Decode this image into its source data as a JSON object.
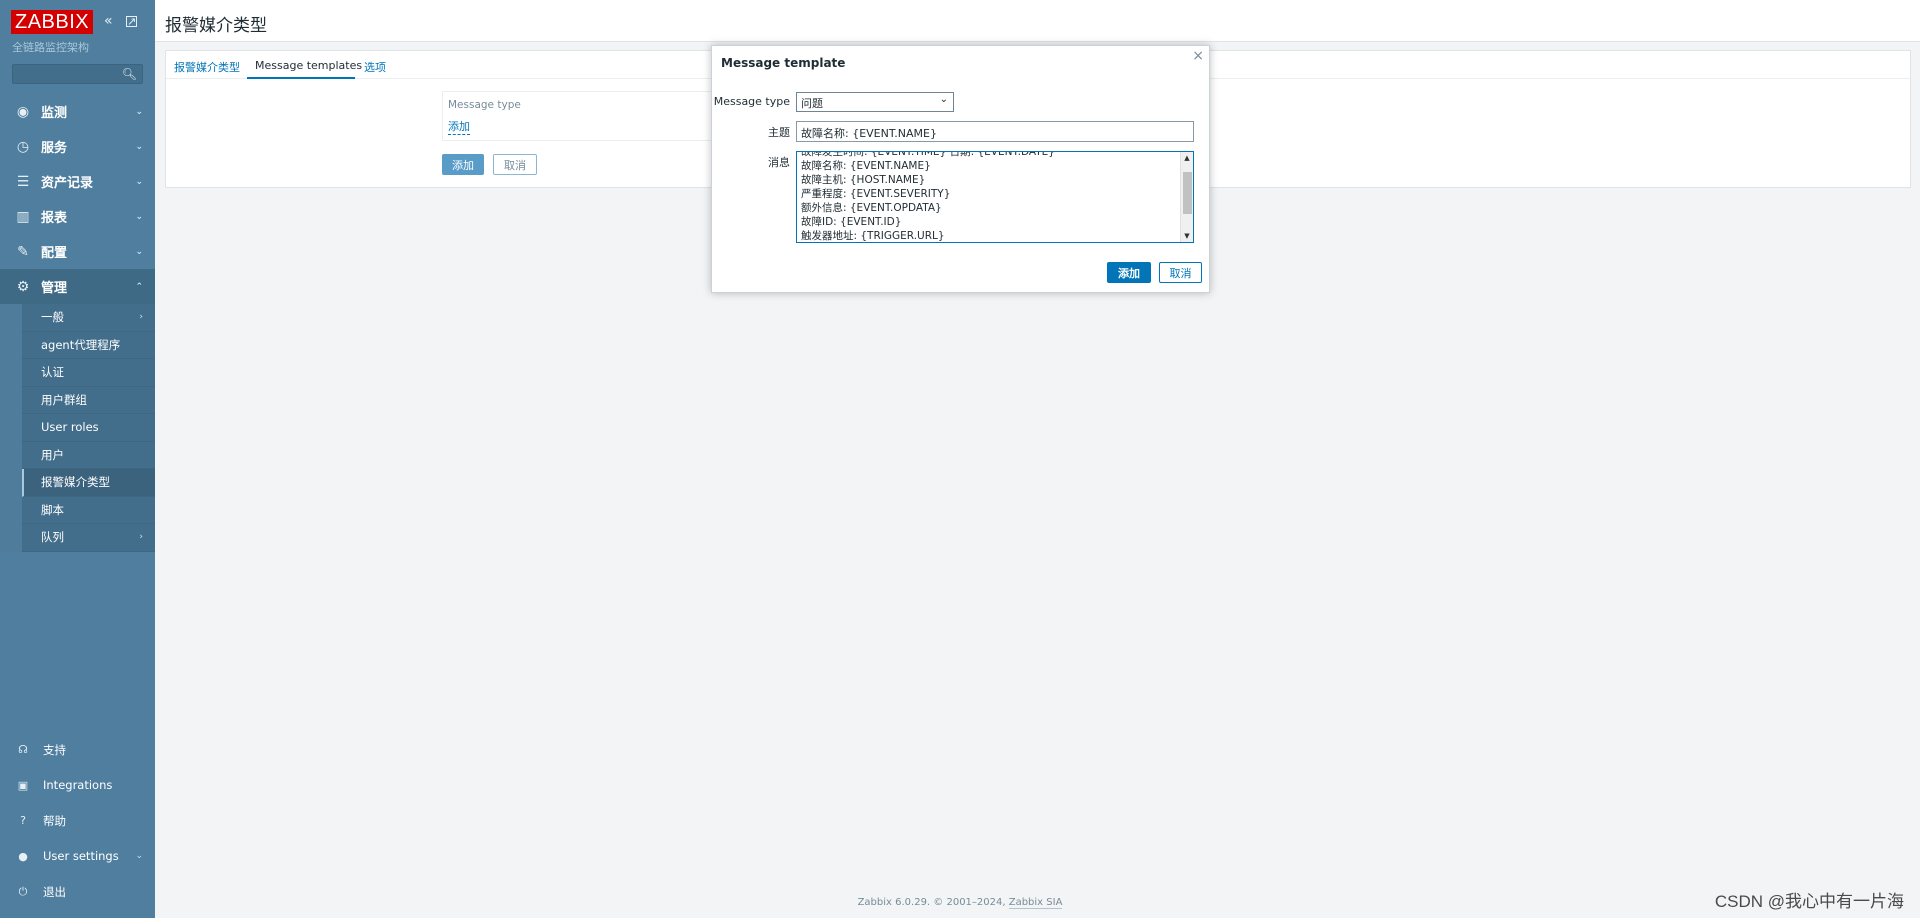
{
  "sidebar": {
    "logo": "ZABBIX",
    "subtitle": "全链路监控架构",
    "collapse_icon": "double-chevron-left-icon",
    "kiosk_icon": "kiosk-mode-icon",
    "search_icon": "search-icon",
    "menu": [
      {
        "label": "监测",
        "icon": "eye-icon"
      },
      {
        "label": "服务",
        "icon": "stopwatch-icon"
      },
      {
        "label": "资产记录",
        "icon": "list-icon"
      },
      {
        "label": "报表",
        "icon": "bar-chart-icon"
      },
      {
        "label": "配置",
        "icon": "wrench-icon"
      },
      {
        "label": "管理",
        "icon": "gear-icon"
      }
    ],
    "submenu": [
      {
        "label": "一般"
      },
      {
        "label": "agent代理程序"
      },
      {
        "label": "认证"
      },
      {
        "label": "用户群组"
      },
      {
        "label": "User roles"
      },
      {
        "label": "用户"
      },
      {
        "label": "报警媒介类型"
      },
      {
        "label": "脚本"
      },
      {
        "label": "队列"
      }
    ],
    "bottom": [
      {
        "label": "支持",
        "icon": "headset-icon"
      },
      {
        "label": "Integrations",
        "icon": "integrations-icon"
      },
      {
        "label": "帮助",
        "icon": "question-icon"
      },
      {
        "label": "User settings",
        "icon": "user-icon"
      },
      {
        "label": "退出",
        "icon": "power-icon"
      }
    ]
  },
  "header": {
    "title": "报警媒介类型"
  },
  "tabs": [
    {
      "label": "报警媒介类型"
    },
    {
      "label": "Message templates"
    },
    {
      "label": "选项"
    }
  ],
  "templates_table": {
    "header": "Message type",
    "add_link": "添加"
  },
  "form_buttons": {
    "add": "添加",
    "cancel": "取消"
  },
  "dialog": {
    "title": "Message template",
    "close": "×",
    "message_type_label": "Message type",
    "message_type_value": "问题",
    "subject_label": "主题",
    "subject_value": "故障名称: {EVENT.NAME}",
    "message_label": "消息",
    "message_lines": [
      "故障发生时间: {EVENT.TIME} 日期: {EVENT.DATE}",
      "故障名称: {EVENT.NAME}",
      "故障主机: {HOST.NAME}",
      "严重程度: {EVENT.SEVERITY}",
      "额外信息: {EVENT.OPDATA}",
      "故障ID: {EVENT.ID}",
      "触发器地址: {TRIGGER.URL}"
    ],
    "add_button": "添加",
    "cancel_button": "取消"
  },
  "footer": {
    "text": "Zabbix 6.0.29. © 2001–2024, ",
    "link": "Zabbix SIA"
  },
  "watermark": "CSDN @我心中有一片海"
}
